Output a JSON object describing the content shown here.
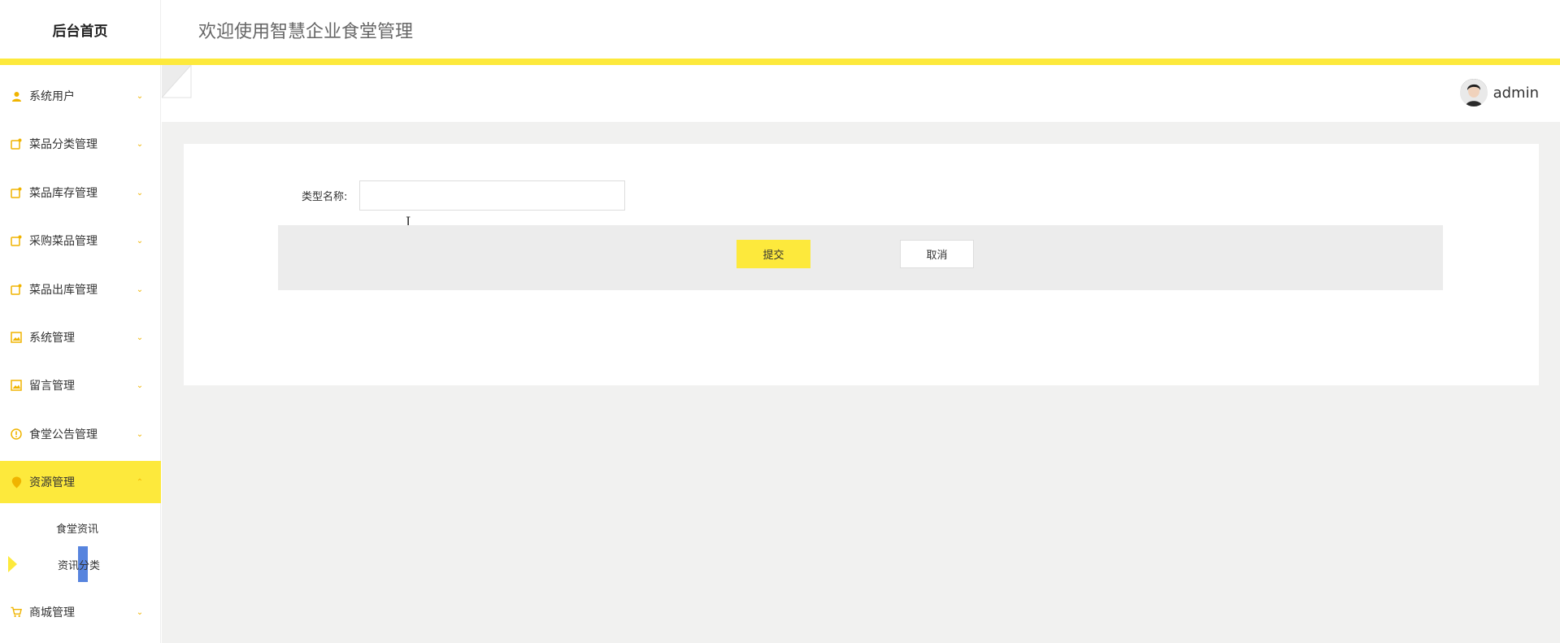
{
  "header": {
    "brand": "后台首页",
    "welcome": "欢迎使用智慧企业食堂管理"
  },
  "colors": {
    "accent": "#fde93c",
    "icon": "#f0b400",
    "content_bg": "#f1f1f0"
  },
  "sidebar": {
    "items": [
      {
        "label": "系统用户",
        "icon": "user-icon"
      },
      {
        "label": "菜品分类管理",
        "icon": "edit-box-icon"
      },
      {
        "label": "菜品库存管理",
        "icon": "edit-box-icon"
      },
      {
        "label": "采购菜品管理",
        "icon": "edit-box-icon"
      },
      {
        "label": "菜品出库管理",
        "icon": "edit-box-icon"
      },
      {
        "label": "系统管理",
        "icon": "image-icon"
      },
      {
        "label": "留言管理",
        "icon": "image-icon"
      },
      {
        "label": "食堂公告管理",
        "icon": "info-circle-icon"
      },
      {
        "label": "资源管理",
        "icon": "location-pin-icon",
        "expanded": true
      },
      {
        "label": "商城管理",
        "icon": "cart-icon"
      }
    ],
    "submenu": [
      {
        "label": "食堂资讯"
      },
      {
        "label": "资讯分类"
      }
    ]
  },
  "topbar": {
    "username": "admin"
  },
  "form": {
    "field_label": "类型名称:",
    "field_value": "",
    "submit_label": "提交",
    "cancel_label": "取消"
  }
}
